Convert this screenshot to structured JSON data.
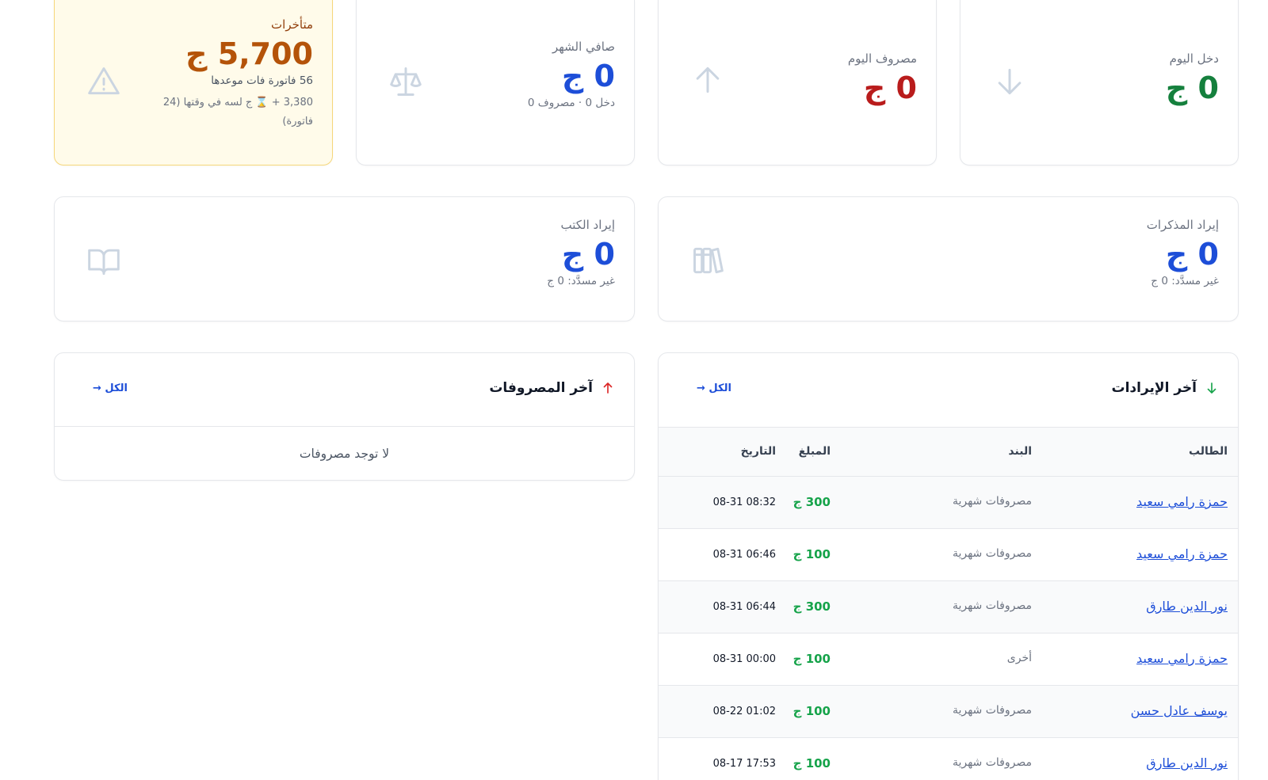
{
  "stats": {
    "income_today": {
      "label": "دخل اليوم",
      "value": "0 ج",
      "icon": "arrow-down-icon"
    },
    "expense_today": {
      "label": "مصروف اليوم",
      "value": "0 ج",
      "icon": "arrow-up-icon"
    },
    "month_net": {
      "label": "صافي الشهر",
      "value": "0 ج",
      "sub": "دخل 0 · مصروف 0",
      "icon": "scale-icon"
    },
    "overdue": {
      "label": "متأخرات",
      "value": "5,700 ج",
      "sub": "56 فاتورة فات موعدها",
      "sub2": "3,380 + ⌛ ج لسه في وقتها (24 فاتورة)",
      "icon": "warning-icon"
    },
    "notes_revenue": {
      "label": "إيراد المذكرات",
      "value": "0 ج",
      "sub": "غير مسدَّد: 0 ج",
      "icon": "books-icon"
    },
    "books_revenue": {
      "label": "إيراد الكتب",
      "value": "0 ج",
      "sub": "غير مسدَّد: 0 ج",
      "icon": "open-book-icon"
    }
  },
  "latest_income": {
    "title": "آخر الإيرادات",
    "see_all": "الكل →",
    "columns": {
      "student": "الطالب",
      "item": "البند",
      "amount": "المبلغ",
      "date": "التاريخ"
    },
    "rows": [
      {
        "student": "حمزة رامي سعيد",
        "item": "مصروفات شهرية",
        "amount": "300 ج",
        "date": "08-31 08:32"
      },
      {
        "student": "حمزة رامي سعيد",
        "item": "مصروفات شهرية",
        "amount": "100 ج",
        "date": "08-31 06:46"
      },
      {
        "student": "نور الدين طارق",
        "item": "مصروفات شهرية",
        "amount": "300 ج",
        "date": "08-31 06:44"
      },
      {
        "student": "حمزة رامي سعيد",
        "item": "أخرى",
        "amount": "100 ج",
        "date": "08-31 00:00"
      },
      {
        "student": "يوسف عادل حسن",
        "item": "مصروفات شهرية",
        "amount": "100 ج",
        "date": "08-22 01:02"
      },
      {
        "student": "نور الدين طارق",
        "item": "مصروفات شهرية",
        "amount": "100 ج",
        "date": "08-17 17:53"
      }
    ]
  },
  "latest_expenses": {
    "title": "آخر المصروفات",
    "see_all": "الكل →",
    "empty": "لا توجد مصروفات"
  },
  "colors": {
    "blue": "#1d4ed8",
    "green": "#15803d",
    "red": "#b91c1c",
    "amber": "#b45309",
    "warn_bg": "#fffbea"
  }
}
